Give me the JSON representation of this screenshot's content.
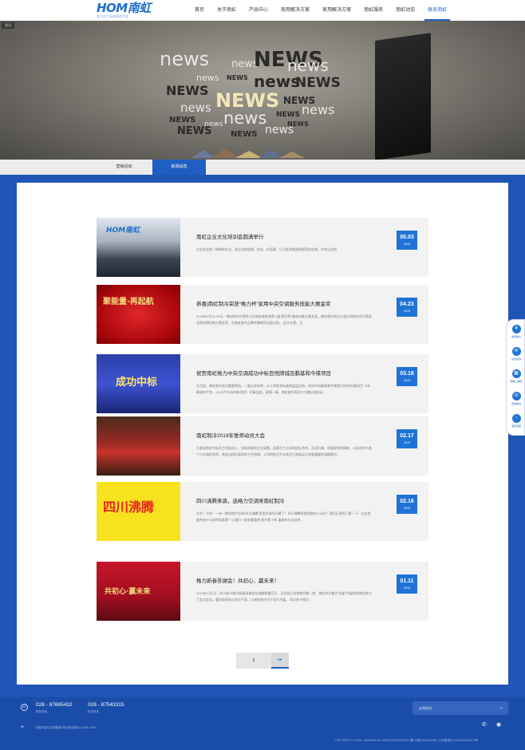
{
  "header": {
    "logo_mark": "HOM南虹",
    "logo_tagline": "室内空气系统服务专家",
    "nav": [
      {
        "label": "首页"
      },
      {
        "label": "关于南虹"
      },
      {
        "label": "产品中心"
      },
      {
        "label": "商用解决方案"
      },
      {
        "label": "家用解决方案"
      },
      {
        "label": "南虹服务"
      },
      {
        "label": "南虹动态"
      },
      {
        "label": "联系南虹"
      }
    ],
    "active_nav": "联系南虹"
  },
  "banner": {
    "tag": "资讯",
    "words": [
      "news",
      "NEWS"
    ]
  },
  "tabs": [
    {
      "label": "营销活动",
      "active": false
    },
    {
      "label": "新闻动态",
      "active": true
    }
  ],
  "news": [
    {
      "title": "南虹企业文化培训会圆满举行",
      "desc": "企业文化是一种精神文化，是企业的理想、信念、价值观、行为准则和道德规范的总和。它和企业的",
      "date": "05.03",
      "year": "2019",
      "thumb_text": "HOM南虹"
    },
    {
      "title": "恭喜|南虹制冷荣获“格力杯”家用中央空调服务技能大赛金奖",
      "desc": "2019年4月16-18日，南虹制冷代表四川区域参加南海第二届“格力杯”服务技能大赛金奖。南虹制冷再次以强大的综合实力荣获全国金牌技能大赛金奖，为南虹制冷品牌传播增添无限光彩。 此次大赛，主...",
      "date": "04.23",
      "year": "2019",
      "thumb_text": "聚能量·再起航"
    },
    {
      "title": "祝贺南虹格力中央空调成功中标百悦牌城及鹏基和今缘项目",
      "desc": "在月初，南虹制冷经过重重筛选，一路过关斩将，从十余家竞标者的层层比拼，成功中标鹏基和今缘格力中央空调项目！8年精致房产型，109万平方米的新项目！好事连连，紧随一周，南虹制冷再次与大鹏达成协议...",
      "date": "03.18",
      "year": "2019",
      "thumb_text": "成功中标"
    },
    {
      "title": "南虹制冷2019年誓师动员大会",
      "desc": "为激发南虹所有员工积极向上、团结进取的企业氛围，培养员工之间的团队合作，互动沟通、积极配合的精神，以促进作为其个人价值的发挥，激发出团队高昂的工作热情，公司特别召开全体员工和高层计划鉴掌握的战略意识...",
      "date": "02.17",
      "year": "2019",
      "thumb_text": ""
    },
    {
      "title": "四川沸腾来袭，选格力空调来南虹制冷",
      "desc": "号外！号外！一年一期的格力空调“四川沸腾”家用空调节开幕了！四川沸腾家装到底有什么好？我们正带你了解一下！在这里能带来什么样的惊喜呢？让我们一起来看看吧 格力第十季 请来参与活动吧...",
      "date": "02.16",
      "year": "2019",
      "thumb_text": "四川沸腾"
    },
    {
      "title": "格力新春答谢会！共初心，赢未来！",
      "desc": "2019年1月2日，四川新兴格力新春答谢会在成都隆重召开，百位核心经销商共聚一堂，南虹作为格力“金星”中级经销商也参与了此次会议。重会现场同心协力气氛，让南虹制冷对于成大开展。 四川新兴格力...",
      "date": "01.11",
      "year": "2019",
      "thumb_text": "共初心·赢未来"
    }
  ],
  "pager": {
    "current": "2",
    "next": "▸▸"
  },
  "side_float": [
    {
      "label": "免费报价",
      "icon": "yuan-icon"
    },
    {
      "label": "在线咨询",
      "icon": "chat-icon"
    },
    {
      "label": "微信二维码",
      "icon": "qrcode-icon"
    },
    {
      "label": "咨询热线",
      "icon": "phone-icon"
    },
    {
      "label": "返回顶部",
      "icon": "arrow-up-icon"
    }
  ],
  "footer": {
    "phone1": "028 - 87665432",
    "phone1_label": "服务热线",
    "phone2": "028 - 87543315",
    "phone2_label": "售后热线",
    "address": "成都市金牛区蓉都城0号大楼总部中心2505-1505",
    "select_label": "友情链接",
    "copyright": "COPYRIGHT © 2015 - NANHOM ALL RIGHTS RESERVED    蜀ICP备16034215号-1    公安备案号 51010502004179号"
  }
}
